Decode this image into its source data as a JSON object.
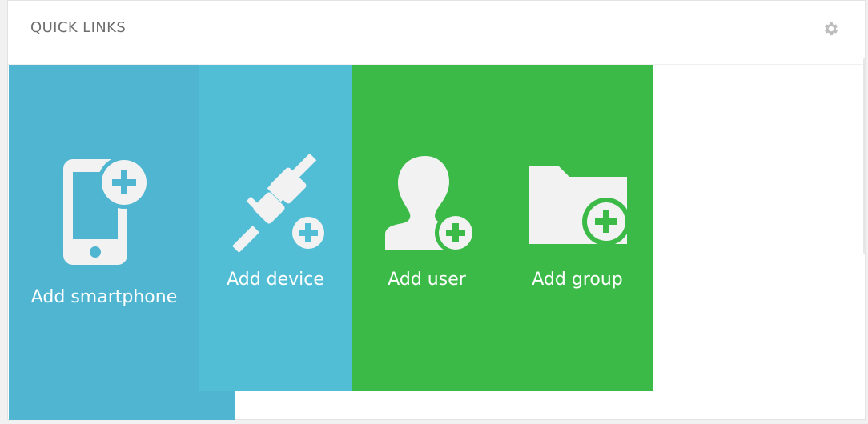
{
  "header": {
    "title": "QUICK LINKS",
    "settings_icon": "gear-icon"
  },
  "tiles": [
    {
      "label": "Add smartphone",
      "icon": "smartphone-add-icon",
      "color": "#4fb5d0"
    },
    {
      "label": "Add device",
      "icon": "plug-add-icon",
      "color": "#52bed6"
    },
    {
      "label": "Add user",
      "icon": "user-add-icon",
      "color": "#3cba48"
    },
    {
      "label": "Add group",
      "icon": "folder-add-icon",
      "color": "#3cba48"
    }
  ],
  "colors": {
    "icon_fill": "#f2f2f2",
    "plus_color_blue": "#4fb5d0",
    "plus_color_green": "#3cba48"
  }
}
